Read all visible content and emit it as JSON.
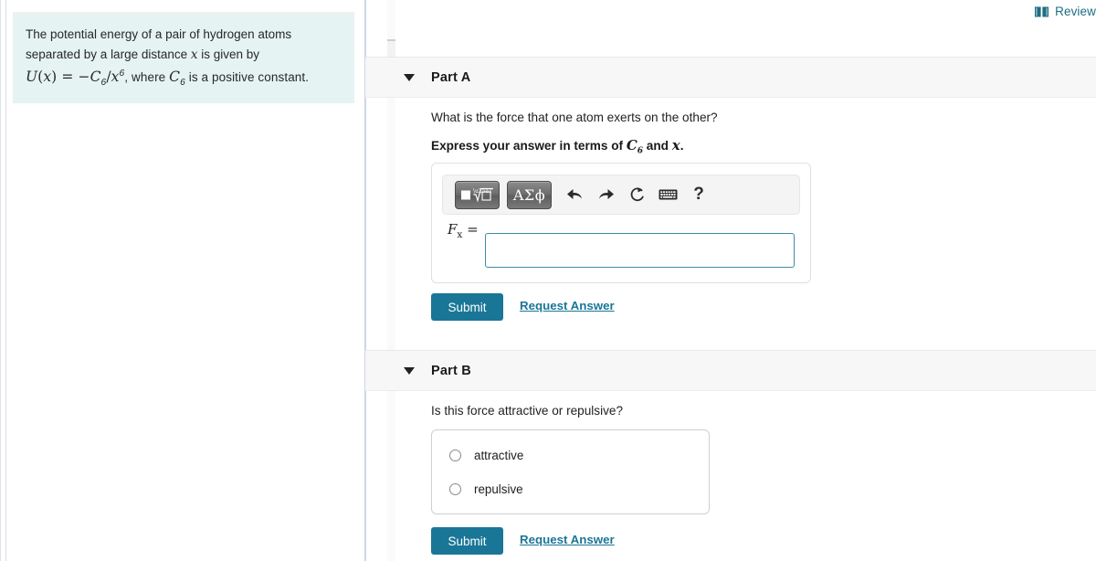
{
  "left_panel": {
    "problem_statement_line1": "The potential energy of a pair of hydrogen atoms",
    "problem_statement_line2_pre": "separated by a large distance ",
    "problem_statement_line2_var": "x",
    "problem_statement_line2_post": " is given by",
    "formula_U": "U",
    "formula_open": "(",
    "formula_x": "x",
    "formula_close": ")",
    "formula_eq": " = −",
    "formula_C": "C",
    "formula_C_sub": "6",
    "formula_slash": "/",
    "formula_x2": "x",
    "formula_x2_sup": "6",
    "formula_tail_pre": ", where ",
    "formula_tail_C": "C",
    "formula_tail_C_sub": "6",
    "formula_tail_post": " is a positive constant."
  },
  "header": {
    "review_label": "Review",
    "review_icon": "book-icon"
  },
  "part_a": {
    "title": "Part A",
    "caret_icon": "chevron-down-icon",
    "question": "What is the force that one atom exerts on the other?",
    "instruction_pre": "Express your answer in terms of ",
    "instruction_C": "C",
    "instruction_C_sub": "6",
    "instruction_mid": " and ",
    "instruction_x": "x",
    "instruction_end": ".",
    "toolbar": {
      "template_button_label": "■√□",
      "template_button_icon": "math-template-icon",
      "symbols_button_label": "ΑΣϕ",
      "symbols_button_icon": "greek-symbols-icon",
      "undo_icon": "undo-icon",
      "redo_icon": "redo-icon",
      "reset_icon": "reset-icon",
      "keyboard_icon": "keyboard-icon",
      "help_label": "?",
      "help_icon": "help-icon"
    },
    "answer_label_F": "F",
    "answer_label_sub": "x",
    "answer_label_eq": "=",
    "answer_value": "",
    "answer_placeholder": "",
    "submit_label": "Submit",
    "request_answer_label": "Request Answer"
  },
  "part_b": {
    "title": "Part B",
    "caret_icon": "chevron-down-icon",
    "question": "Is this force attractive or repulsive?",
    "choices": [
      {
        "label": "attractive",
        "selected": false
      },
      {
        "label": "repulsive",
        "selected": false
      }
    ],
    "submit_label": "Submit",
    "request_answer_label": "Request Answer"
  },
  "colors": {
    "accent_teal": "#1a7697",
    "problem_box_bg": "#e6f3f3",
    "part_header_bg": "#f7f7f7",
    "input_border": "#3f8ca3"
  }
}
